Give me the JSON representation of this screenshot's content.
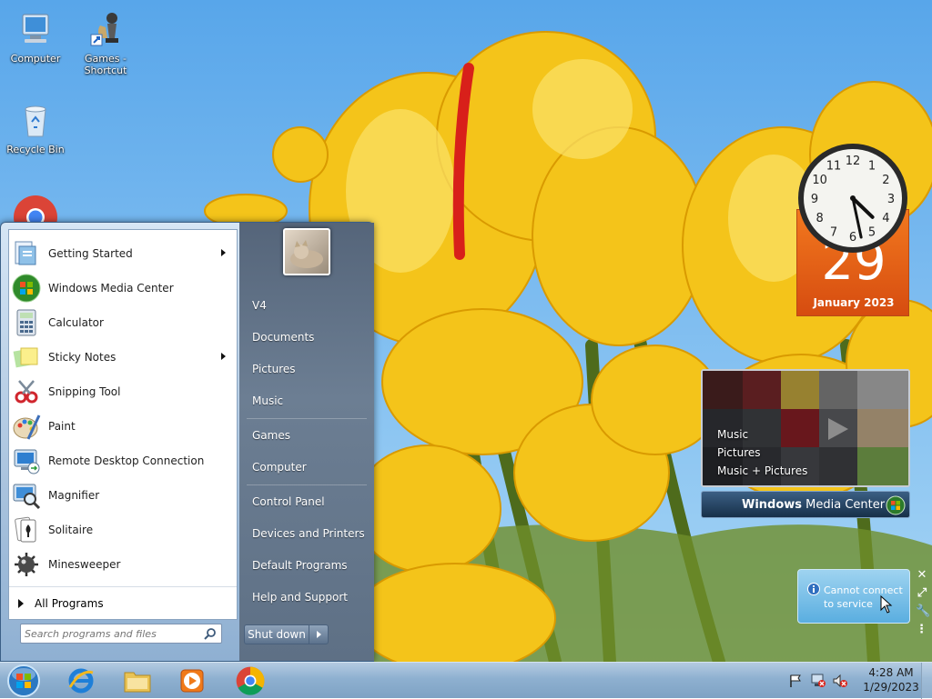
{
  "desktop": {
    "icons": [
      {
        "label": "Computer"
      },
      {
        "label": "Games -\nShortcut"
      },
      {
        "label": "Recycle Bin"
      }
    ]
  },
  "start_menu": {
    "programs": [
      {
        "label": "Getting Started",
        "submenu": true
      },
      {
        "label": "Windows Media Center",
        "submenu": false
      },
      {
        "label": "Calculator",
        "submenu": false
      },
      {
        "label": "Sticky Notes",
        "submenu": true
      },
      {
        "label": "Snipping Tool",
        "submenu": false
      },
      {
        "label": "Paint",
        "submenu": false
      },
      {
        "label": "Remote Desktop Connection",
        "submenu": false
      },
      {
        "label": "Magnifier",
        "submenu": false
      },
      {
        "label": "Solitaire",
        "submenu": false
      },
      {
        "label": "Minesweeper",
        "submenu": false
      }
    ],
    "all_programs": "All Programs",
    "search_placeholder": "Search programs and files",
    "right_items": [
      "V4",
      "Documents",
      "Pictures",
      "Music",
      "Games",
      "Computer",
      "Control Panel",
      "Devices and Printers",
      "Default Programs",
      "Help and Support"
    ],
    "shutdown_label": "Shut down"
  },
  "gadgets": {
    "calendar": {
      "day": "29",
      "month_year": "January 2023"
    },
    "clock": {
      "hour": 4,
      "minute": 28,
      "numbers": [
        "12",
        "1",
        "2",
        "3",
        "4",
        "5",
        "6",
        "7",
        "8",
        "9",
        "10",
        "11"
      ]
    },
    "media_center": {
      "options": [
        "Music",
        "Pictures",
        "Music + Pictures"
      ],
      "title_bold": "Windows",
      "title_rest": " Media Center"
    },
    "feed": {
      "message": "Cannot connect to service"
    }
  },
  "taskbar": {
    "time": "4:28 AM",
    "date": "1/29/2023",
    "pinned": [
      "internet-explorer",
      "file-explorer",
      "media-player",
      "chrome"
    ]
  },
  "colors": {
    "accent": "#f06a1c",
    "taskbar": "#8eb0d0",
    "tulip": "#f5c518"
  }
}
